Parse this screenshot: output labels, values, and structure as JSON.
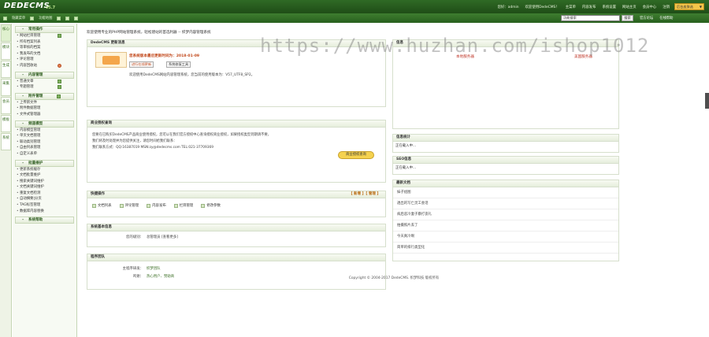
{
  "header": {
    "logo": "DEDECMS",
    "version": "v5.7",
    "nav": [
      "您好：admin",
      "欢迎使用DedeCMS！",
      "主菜单",
      "内容发布",
      "系统设置",
      "网站主页",
      "会员中心",
      "注销"
    ],
    "skin": "后台皮肤选",
    "sub_left": [
      "隐藏菜单",
      "功能地图"
    ],
    "search_placeholder": "功能搜索",
    "search_button": "搜索",
    "sub_links": [
      "官方论坛",
      "在线帮助"
    ]
  },
  "vtabs": [
    "核心",
    "模块",
    "生成",
    "采集",
    "会员",
    "模板",
    "系统"
  ],
  "menu": [
    {
      "title": "常用操作",
      "items": [
        "网站栏目管理",
        "所有档案列表",
        "等审核的档案",
        "我发布的文档",
        "评论管理",
        "内容回收站"
      ]
    },
    {
      "title": "内容管理",
      "items": [
        "普通文章",
        "专题管理"
      ]
    },
    {
      "title": "附件管理",
      "items": [
        "上传新文件",
        "附件数据管理",
        "文件式管理器"
      ]
    },
    {
      "title": "频道模型",
      "items": [
        "内容模型管理",
        "单页文档管理",
        "联动类别管理",
        "自由列表管理",
        "自定义表单"
      ]
    },
    {
      "title": "批量维护",
      "items": [
        "更新系统缓存",
        "文档批量维护",
        "搜索关键词维护",
        "文档关键词维护",
        "重复文档检测",
        "自动摘要|分页",
        "TAG标签管理",
        "数据库内容替换"
      ]
    },
    {
      "title": "系统帮助",
      "items": []
    }
  ],
  "main": {
    "breadcrumb": "欢迎使用专业的PHP网站管理系统，轻松建站的首选利器 -- 织梦内容管理系统",
    "watermark": "https://www.huzhan.com/ishop1012",
    "update_panel": {
      "title": "DedeCMS 更新消息",
      "warn": "您系统版本最后更新时间为：2018-01-09",
      "btn1": "进行在线更新",
      "btn2": "系统修复工具",
      "welcome": "欢迎使用DedeCMS网站内容管理系统，您当前的使用版本为：V57_UTF8_SP2。"
    },
    "biz_panel": {
      "title": "商业授权查询",
      "line1": "您要在已购买DedeCMS产品商业使用授权，您可以在我们官方授权中心查询授权商业授权，如果授权类型到期请不要，",
      "line2": "我们将及时处理并为您提供关注，请您时间给我们联系：",
      "line3": "我们联系方式：QQ:16387019 MSN:zy@dedecms.com TEL:021-37709369",
      "btn": "商业授权查询"
    },
    "quick_panel": {
      "title": "快捷操作",
      "right": "【 新增 】【 管理 】",
      "ops": [
        "文档列表",
        "评论管理",
        "内容发布",
        "栏目管理",
        "修改参数"
      ]
    },
    "sysinfo_panel": {
      "title": "系统基本信息",
      "key": "您的级别：",
      "value": "总管理员 [查看更多]"
    },
    "team_panel": {
      "title": "程序团队",
      "rows": [
        {
          "k": "主程序研发：",
          "v": "织梦团队"
        },
        {
          "k": "鸣谢：",
          "v": "热心用户、赞助商"
        }
      ]
    },
    "server_panel": {
      "title": "信息",
      "label1": "本地服务器",
      "label2": "美国服务器"
    },
    "info_panel": {
      "title": "信息统计",
      "text": "正在载入中..."
    },
    "seo_panel": {
      "title": "SEO信息",
      "text": "正在载入中..."
    },
    "latest_panel": {
      "title": "最新文档",
      "items": [
        "妹子组图",
        "透出的写亡灵工会话",
        "病后恶冷妻子暴打丧礼",
        "拍摄照片丢了",
        "今天真冷啊",
        "简单的排行类型化"
      ]
    },
    "copyright": "Copyright © 2004-2017 DedeCMS. 织梦科技 版权所有"
  }
}
